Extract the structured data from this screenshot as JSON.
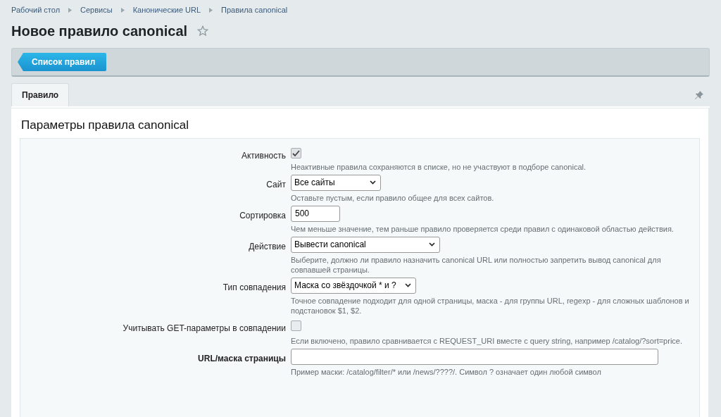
{
  "breadcrumbs": [
    "Рабочий стол",
    "Сервисы",
    "Канонические URL",
    "Правила canonical"
  ],
  "page_title": "Новое правило canonical",
  "favorite": false,
  "toolbar": {
    "button": "Список правил"
  },
  "tabs": [
    {
      "label": "Правило",
      "selected": true
    }
  ],
  "section_title": "Параметры правила canonical",
  "fields": [
    {
      "kind": "checkbox",
      "label": "Активность",
      "required": false,
      "checked": true,
      "hint": "Неактивные правила сохраняются в списке, но не участвуют в подборе canonical."
    },
    {
      "kind": "select",
      "label": "Сайт",
      "required": false,
      "value": "Все сайты",
      "hint": "Оставьте пустым, если правило общее для всех сайтов."
    },
    {
      "kind": "text",
      "label": "Сортировка",
      "required": false,
      "value": "500",
      "hint": "Чем меньше значение, тем раньше правило проверяется среди правил с одинаковой областью действия."
    },
    {
      "kind": "select",
      "label": "Действие",
      "required": false,
      "value": "Вывести canonical",
      "hint": "Выберите, должно ли правило назначить canonical URL или полностью запретить вывод canonical для совпавшей страницы."
    },
    {
      "kind": "select",
      "label": "Тип совпадения",
      "required": false,
      "value": "Маска со звёздочкой * и ?",
      "hint": "Точное совпадение подходит для одной страницы, маска - для группы URL, regexp - для сложных шаблонов и подстановок $1, $2."
    },
    {
      "kind": "checkbox",
      "label": "Учитывать GET-параметры в совпадении",
      "required": false,
      "checked": false,
      "hint": "Если включено, правило сравнивается с REQUEST_URI вместе с query string, например /catalog/?sort=price."
    },
    {
      "kind": "text",
      "label": "URL/маска страницы",
      "required": true,
      "hint": "Пример маски: /catalog/filter/* или /news/????/. Символ ? означает один любой символ"
    }
  ]
}
